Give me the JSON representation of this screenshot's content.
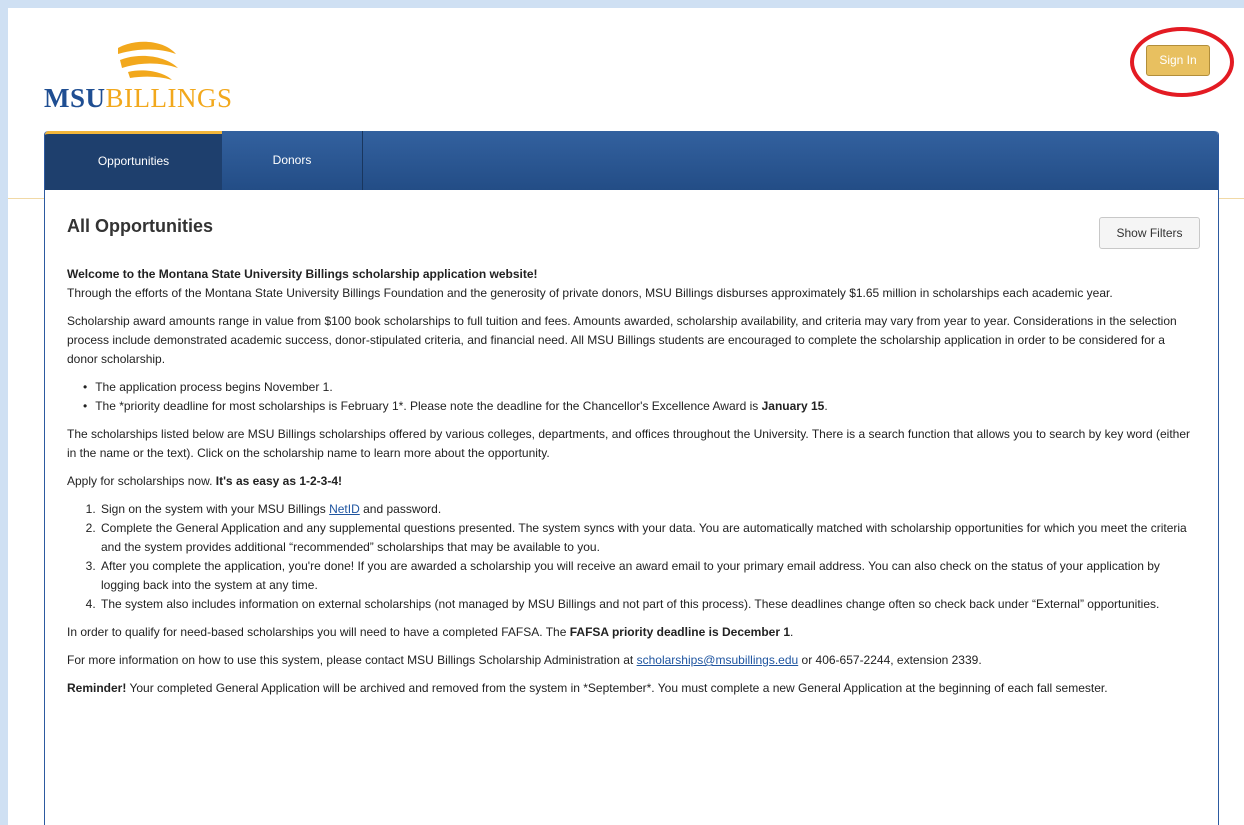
{
  "logo": {
    "msu": "MSU",
    "billings": "BILLINGS"
  },
  "header": {
    "sign_in": "Sign In"
  },
  "nav": {
    "tabs": [
      {
        "label": "Opportunities"
      },
      {
        "label": "Donors"
      }
    ]
  },
  "main": {
    "title": "All Opportunities",
    "show_filters": "Show Filters",
    "welcome_title": "Welcome to the Montana State University Billings scholarship application website!",
    "welcome_body": "Through the efforts of the Montana State University Billings Foundation and the generosity of private donors, MSU Billings disburses approximately $1.65 million in scholarships each academic year.",
    "para_award": "Scholarship award amounts range in value from $100 book scholarships to full tuition and fees. Amounts awarded, scholarship availability, and criteria may vary from year to year. Considerations in the selection process include demonstrated academic success, donor-stipulated criteria, and financial need. All MSU Billings students are encouraged to complete the scholarship application in order to be considered for a donor scholarship.",
    "bullets": {
      "b1": "The application process begins November 1.",
      "b2_pre": "The *priority deadline for most scholarships is February 1*. Please note the deadline for the Chancellor's Excellence Award is ",
      "b2_bold": "January 15",
      "b2_post": "."
    },
    "para_listed": "The scholarships listed below are MSU Billings scholarships offered by various colleges, departments, and offices throughout the University. There is a search function that allows you to search by key word (either in the name or the text). Click on the scholarship name to learn more about the opportunity.",
    "apply_pre": "Apply for scholarships now. ",
    "apply_bold": "It's as easy as 1-2-3-4!",
    "steps": {
      "s1_pre": "Sign on the system with your MSU Billings ",
      "s1_link": "NetID",
      "s1_post": " and password.",
      "s2": "Complete the General Application and any supplemental questions presented. The system syncs with your data. You are automatically matched with scholarship opportunities for which you meet the criteria and the system provides additional “recommended” scholarships that may be available to you.",
      "s3": "After you complete the application, you're done! If you are awarded a scholarship you will receive an award email to your primary email address. You can also check on the status of your application by logging back into the system at any time.",
      "s4": "The system also includes information on external scholarships (not managed by MSU Billings and not part of this process). These deadlines change often so check back under “External” opportunities."
    },
    "fafsa_pre": "In order to qualify for need-based scholarships you will need to have a completed FAFSA. The ",
    "fafsa_bold": "FAFSA priority deadline is December 1",
    "fafsa_post": ".",
    "contact_pre": "For more information on how to use this system, please contact MSU Billings Scholarship Administration at ",
    "contact_email": "scholarships@msubillings.edu",
    "contact_post": " or 406-657-2244, extension 2339.",
    "reminder_bold": "Reminder!",
    "reminder_text": " Your completed General Application will be archived and removed from the system in *September*. You must complete a new General Application at the beginning of each fall semester."
  },
  "colors": {
    "brand_blue": "#1f4e92",
    "brand_gold": "#f2a81c",
    "annotation_red": "#e31b23"
  }
}
